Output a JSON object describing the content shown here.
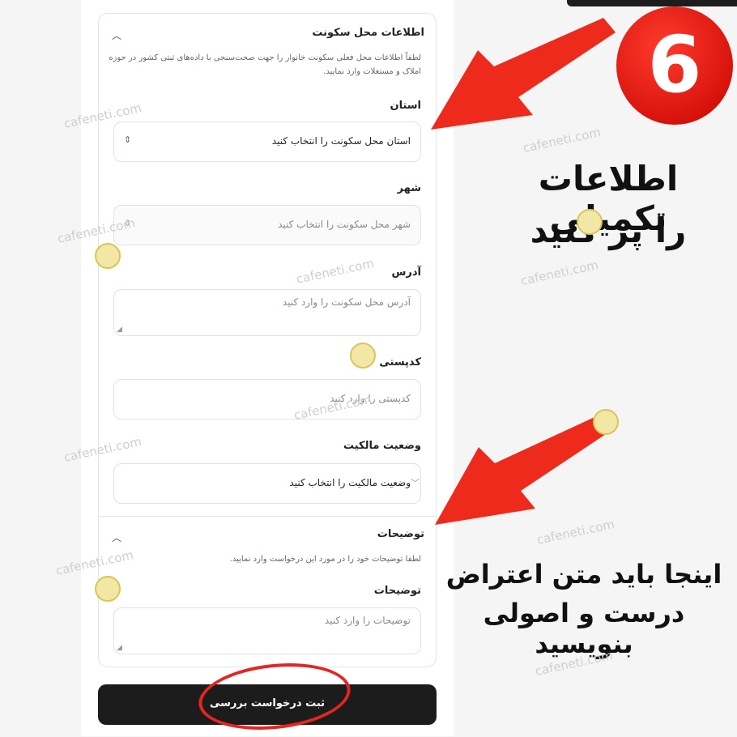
{
  "residence": {
    "title": "اطلاعات محل سکونت",
    "description": "لطفاً اطلاعات محل فعلی سکونت خانوار را جهت صحت‌سنجی با داده‌های ثبتی کشور در حوزه املاک و مستغلات وارد نمایید.",
    "province_label": "استان",
    "province_value": "استان محل سکونت را انتخاب کنید",
    "city_label": "شهر",
    "city_placeholder": "شهر محل سکونت را انتخاب کنید",
    "address_label": "آدرس",
    "address_placeholder": "آدرس محل سکونت را وارد کنید",
    "postal_label": "کدپستی",
    "postal_placeholder": "کدپستی را وارد کنید",
    "ownership_label": "وضعیت مالکیت",
    "ownership_value": "وضعیت مالکیت را انتخاب کنید"
  },
  "notes": {
    "title": "توضیحات",
    "description": "لطفا توضیحات خود را در مورد این درخواست وارد نمایید.",
    "label": "توضیحات",
    "placeholder": "توضیحات را وارد کنید"
  },
  "submit_label": "ثبت درخواست بررسی",
  "overlay": {
    "step_number": "6",
    "headline_1": "اطلاعات تکمیلی",
    "headline_2": "را پر کنید",
    "note_1": "اینجا باید متن اعتراض",
    "note_2": "درست و اصولی بنویسید",
    "watermark": "cafeneti.com"
  },
  "colors": {
    "accent": "#e52521",
    "button": "#1c1c1c"
  }
}
